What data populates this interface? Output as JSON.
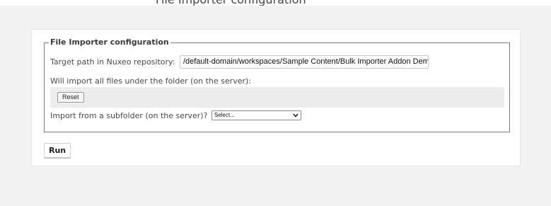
{
  "header": {
    "partial_title": "File Importer configuration"
  },
  "config": {
    "legend": "File Importer configuration",
    "target_path_label": "Target path in Nuxeo repository:",
    "target_path_value": "/default-domain/workspaces/Sample Content/Bulk Importer Addon Demo",
    "will_import_text": "Will import all files under the folder (on the server):",
    "reset_label": "Reset",
    "subfolder_label": "Import from a subfolder (on the server)?",
    "subfolder_selected": "Select..."
  },
  "actions": {
    "run_label": "Run"
  },
  "icons": {
    "select_arrow": "chevron-down-icon"
  }
}
